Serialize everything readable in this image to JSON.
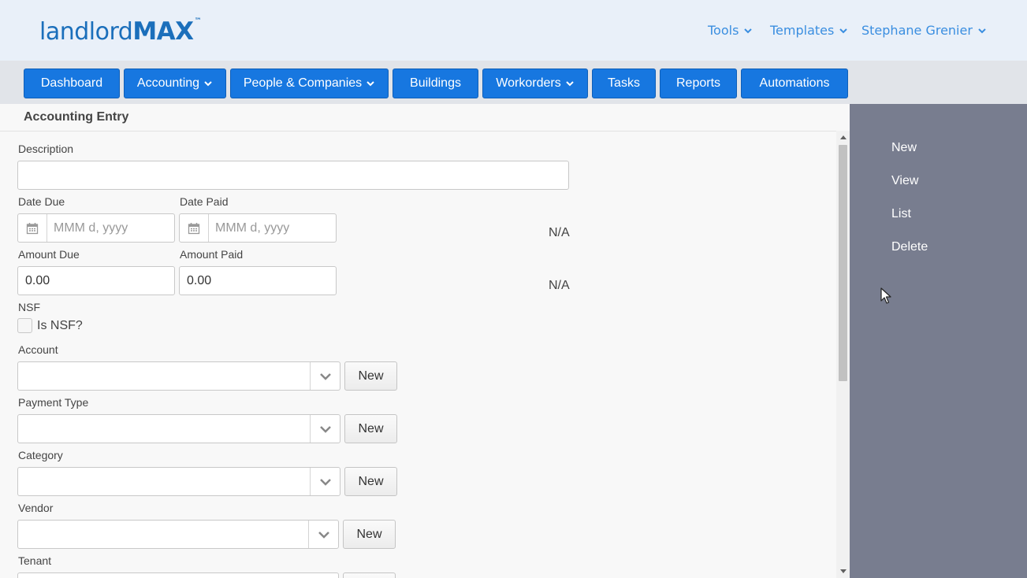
{
  "brand": {
    "light": "landlord",
    "bold": "MAX",
    "tm": "™"
  },
  "top_menu": {
    "tools": "Tools",
    "templates": "Templates",
    "user": "Stephane Grenier"
  },
  "nav": {
    "dashboard": "Dashboard",
    "accounting": "Accounting",
    "people": "People & Companies",
    "buildings": "Buildings",
    "workorders": "Workorders",
    "tasks": "Tasks",
    "reports": "Reports",
    "automations": "Automations"
  },
  "panel": {
    "title": "Accounting Entry"
  },
  "form": {
    "description_label": "Description",
    "description_value": "",
    "date_due_label": "Date Due",
    "date_due_placeholder": "MMM d, yyyy",
    "date_paid_label": "Date Paid",
    "date_paid_placeholder": "MMM d, yyyy",
    "date_na": "N/A",
    "amount_due_label": "Amount Due",
    "amount_due_value": "0.00",
    "amount_paid_label": "Amount Paid",
    "amount_paid_value": "0.00",
    "amount_na": "N/A",
    "nsf_label": "NSF",
    "nsf_checkbox_label": "Is NSF?",
    "account_label": "Account",
    "payment_type_label": "Payment Type",
    "category_label": "Category",
    "vendor_label": "Vendor",
    "tenant_label": "Tenant",
    "new_label": "New"
  },
  "side_menu": {
    "new": "New",
    "view": "View",
    "list": "List",
    "delete": "Delete"
  },
  "colors": {
    "header_bg": "#e9f0f9",
    "nav_button": "#1777e0",
    "side_panel": "#787d8f",
    "link": "#3a8ee0"
  }
}
